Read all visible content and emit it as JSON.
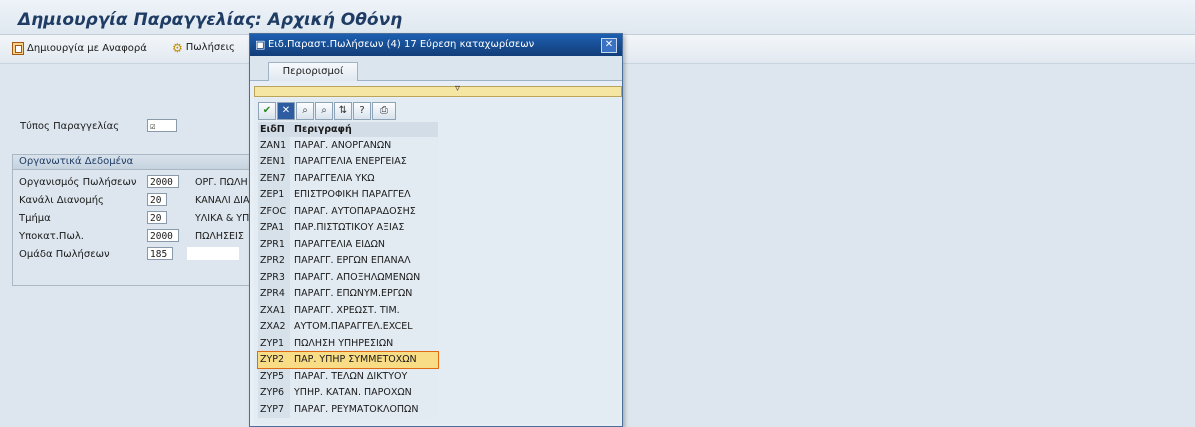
{
  "window": {
    "title": "Δημιουργία Παραγγελίας: Αρχική Οθόνη"
  },
  "toolbar": {
    "create_with_ref": "Δημιουργία με Αναφορά",
    "sales": "Πωλήσεις"
  },
  "form": {
    "order_type_label": "Τύπος Παραγγελίας",
    "org_group_title": "Οργανωτικά Δεδομένα",
    "fields": [
      {
        "label": "Οργανισμός Πωλήσεων",
        "value": "2000",
        "desc": "ΟΡΓ. ΠΩΛΗ"
      },
      {
        "label": "Κανάλι Διανομής",
        "value": "20",
        "desc": "ΚΑΝΑΛΙ ΔΙΑ"
      },
      {
        "label": "Τμήμα",
        "value": "20",
        "desc": "ΥΛΙΚΑ & ΥΠ"
      },
      {
        "label": "Υποκατ.Πωλ.",
        "value": "2000",
        "desc": "ΠΩΛΗΣΕΙΣ"
      },
      {
        "label": "Ομάδα Πωλήσεων",
        "value": "185",
        "desc": ""
      }
    ]
  },
  "dialog": {
    "title": "Ειδ.Παραστ.Πωλήσεων (4)  17 Εύρεση καταχωρίσεων",
    "tab": "Περιορισμοί",
    "columns": {
      "code": "ΕιδΠ",
      "desc": "Περιγραφή"
    },
    "rows": [
      {
        "code": "ZAN1",
        "desc": "ΠΑΡΑΓ. ΑΝΟΡΓΑΝΩΝ"
      },
      {
        "code": "ZEN1",
        "desc": "ΠΑΡΑΓΓΕΛΙΑ ΕΝΕΡΓΕΙΑΣ"
      },
      {
        "code": "ZEN7",
        "desc": "ΠΑΡΑΓΓΕΛΙΑ ΥΚΩ"
      },
      {
        "code": "ZEP1",
        "desc": "ΕΠΙΣΤΡΟΦΙΚΗ ΠΑΡΑΓΓΕΛ"
      },
      {
        "code": "ZFOC",
        "desc": "ΠΑΡΑΓ. ΑΥΤΟΠΑΡΑΔΟΣΗΣ"
      },
      {
        "code": "ZPA1",
        "desc": "ΠΑΡ.ΠΙΣΤΩΤΙΚΟΥ ΑΞΙΑΣ"
      },
      {
        "code": "ZPR1",
        "desc": "ΠΑΡΑΓΓΕΛΙΑ ΕΙΔΩΝ"
      },
      {
        "code": "ZPR2",
        "desc": "ΠΑΡΑΓΓ. ΕΡΓΩΝ ΕΠΑΝΑΛ"
      },
      {
        "code": "ZPR3",
        "desc": "ΠΑΡΑΓΓ. ΑΠΟΞΗΛΩΜΕΝΩΝ"
      },
      {
        "code": "ZPR4",
        "desc": "ΠΑΡΑΓΓ. ΕΠΩΝΥΜ.ΕΡΓΩΝ"
      },
      {
        "code": "ZXA1",
        "desc": "ΠΑΡΑΓΓ. ΧΡΕΩΣΤ. ΤΙΜ."
      },
      {
        "code": "ZXA2",
        "desc": "ΑΥΤΟΜ.ΠΑΡΑΓΓΕΛ.EXCEL"
      },
      {
        "code": "ZYP1",
        "desc": "ΠΩΛΗΣΗ ΥΠΗΡΕΣΙΩΝ"
      },
      {
        "code": "ZYP2",
        "desc": "ΠΑΡ. ΥΠΗΡ ΣΥΜΜΕΤΟΧΩΝ"
      },
      {
        "code": "ZYP5",
        "desc": "ΠΑΡΑΓ. ΤΕΛΩΝ ΔΙΚΤΥΟΥ"
      },
      {
        "code": "ZYP6",
        "desc": "ΥΠΗΡ. ΚΑΤΑΝ. ΠΑΡΟΧΩΝ"
      },
      {
        "code": "ZYP7",
        "desc": "ΠΑΡΑΓ. ΡΕΥΜΑΤΟΚΛΟΠΩΝ"
      }
    ]
  }
}
